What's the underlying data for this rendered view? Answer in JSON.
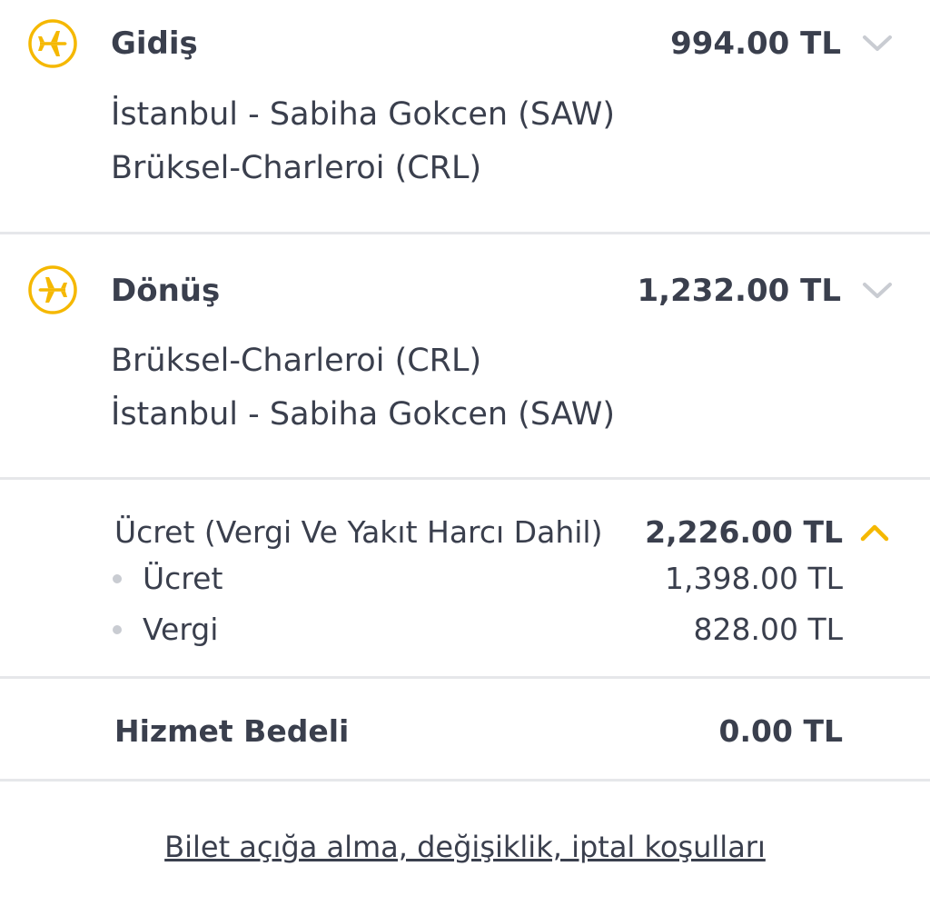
{
  "outbound": {
    "title": "Gidiş",
    "price": "994.00 TL",
    "route_from": "İstanbul - Sabiha Gokcen (SAW)",
    "route_to": "Brüksel-Charleroi (CRL)"
  },
  "return": {
    "title": "Dönüş",
    "price": "1,232.00 TL",
    "route_from": "Brüksel-Charleroi (CRL)",
    "route_to": "İstanbul - Sabiha Gokcen (SAW)"
  },
  "fare": {
    "title": "Ücret (Vergi Ve Yakıt Harcı Dahil)",
    "total": "2,226.00 TL",
    "items": [
      {
        "label": "Ücret",
        "value": "1,398.00 TL"
      },
      {
        "label": "Vergi",
        "value": "828.00 TL"
      }
    ]
  },
  "service": {
    "label": "Hizmet Bedeli",
    "value": "0.00 TL"
  },
  "terms_link": "Bilet açığa alma, değişiklik, iptal koşulları",
  "colors": {
    "accent": "#f5b800",
    "text": "#3a3f4d",
    "divider": "#e6e7ea",
    "chevron": "#c9ccd2"
  },
  "icons": {
    "outbound": "airplane-departure-icon",
    "return": "airplane-return-icon",
    "collapsed": "chevron-down-icon",
    "expanded": "chevron-up-icon"
  }
}
